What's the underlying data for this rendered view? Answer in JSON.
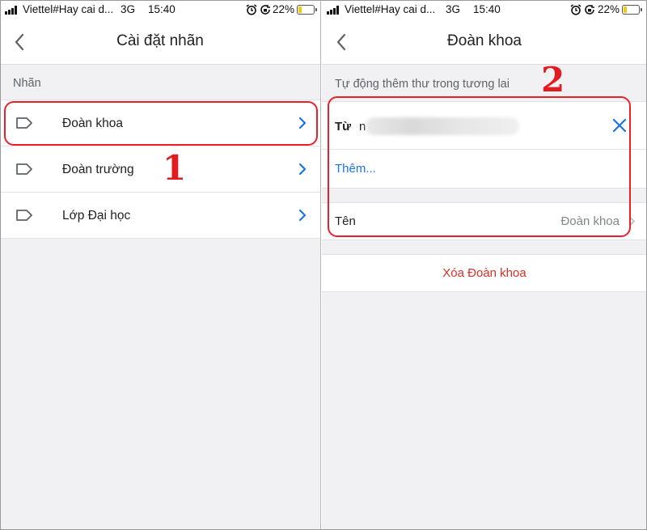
{
  "status_bar": {
    "carrier": "Viettel#Hay cai d...",
    "network": "3G",
    "time": "15:40",
    "battery_percent": "22%",
    "battery_level": 0.22,
    "battery_color": "#f6c90e",
    "icons": [
      "signal-icon",
      "alarm-icon",
      "rotation-lock-icon",
      "battery-icon"
    ]
  },
  "left_screen": {
    "nav": {
      "title": "Cài đặt nhãn",
      "back_icon": "chevron-left-icon"
    },
    "section_label": "Nhãn",
    "labels": [
      {
        "name": "Đoàn khoa",
        "icon": "label-tag-icon"
      },
      {
        "name": "Đoàn trường",
        "icon": "label-tag-icon"
      },
      {
        "name": "Lớp Đại học",
        "icon": "label-tag-icon"
      }
    ],
    "step_number": "1"
  },
  "right_screen": {
    "nav": {
      "title": "Đoàn khoa",
      "back_icon": "chevron-left-icon"
    },
    "auto_label": "Tự động thêm thư trong tương lai",
    "from_label": "Từ",
    "from_value": "n",
    "more_link": "Thêm...",
    "name_label": "Tên",
    "name_value": "Đoàn khoa",
    "delete_label": "Xóa Đoàn khoa",
    "step_number": "2"
  },
  "colors": {
    "accent_blue": "#1a73e8",
    "delete_red": "#d93025",
    "annotation_red": "#e8202a"
  }
}
